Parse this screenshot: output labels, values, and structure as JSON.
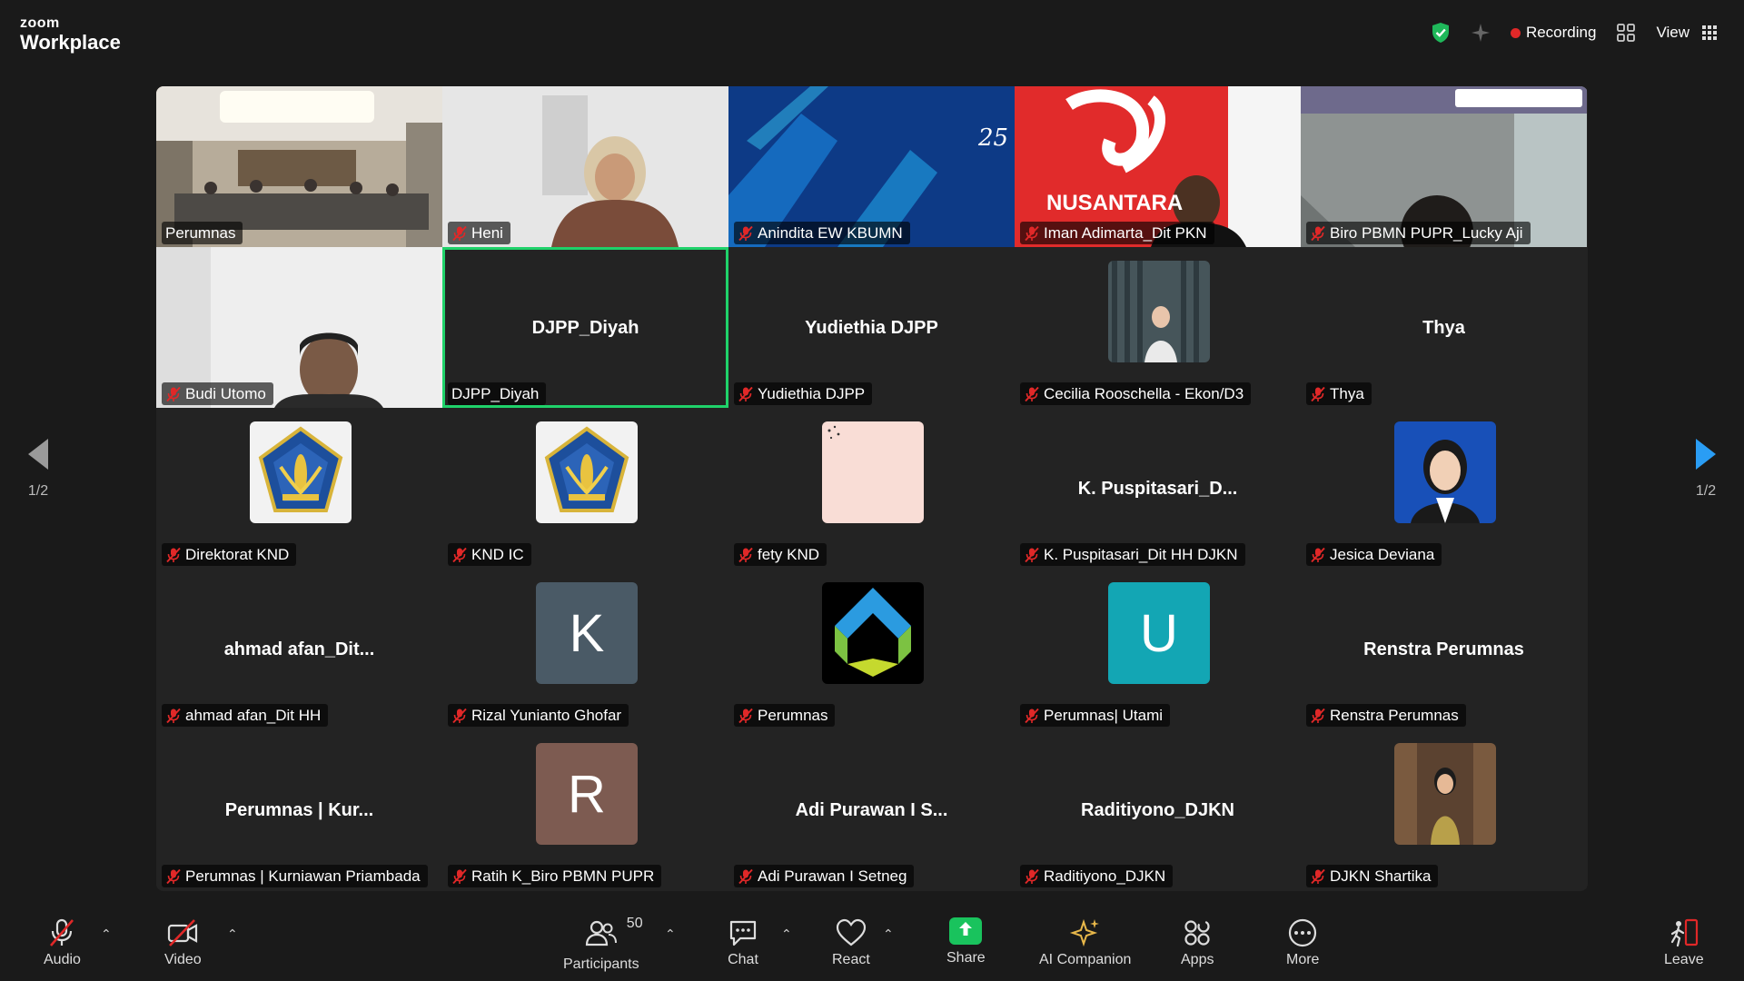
{
  "app": {
    "brand_small": "zoom",
    "brand_big": "Workplace"
  },
  "topbar": {
    "recording_label": "Recording",
    "view_label": "View"
  },
  "colors": {
    "accent_green": "#1fd26a",
    "recording_red": "#e02828",
    "arrow_blue": "#2a9df4",
    "mute_red": "#e02828"
  },
  "pages": {
    "left": "1/2",
    "right": "1/2"
  },
  "tiles": [
    {
      "name": "Perumnas",
      "muted": false,
      "kind": "video-room"
    },
    {
      "name": "Heni",
      "muted": true,
      "kind": "video-person"
    },
    {
      "name": "Anindita EW KBUMN",
      "muted": true,
      "kind": "video-blue"
    },
    {
      "name": "Iman Adimarta_Dit PKN",
      "muted": true,
      "kind": "video-red",
      "overlay_text": "NUSANTARA"
    },
    {
      "name": "Biro PBMN PUPR_Lucky Aji",
      "muted": true,
      "kind": "video-gray"
    },
    {
      "name": "Budi Utomo",
      "muted": true,
      "kind": "video-person2"
    },
    {
      "name": "DJPP_Diyah",
      "muted": false,
      "kind": "name",
      "center": "DJPP_Diyah",
      "active": true
    },
    {
      "name": "Yudiethia DJPP",
      "muted": true,
      "kind": "name",
      "center": "Yudiethia DJPP"
    },
    {
      "name": "Cecilia Rooschella - Ekon/D3",
      "muted": true,
      "kind": "photo-cecilia"
    },
    {
      "name": "Thya",
      "muted": true,
      "kind": "name",
      "center": "Thya"
    },
    {
      "name": "Direktorat KND",
      "muted": true,
      "kind": "emblem"
    },
    {
      "name": "KND IC",
      "muted": true,
      "kind": "emblem"
    },
    {
      "name": "fety KND",
      "muted": true,
      "kind": "pink"
    },
    {
      "name": "K. Puspitasari_Dit HH DJKN",
      "muted": true,
      "kind": "name",
      "center": "K.  Puspitasari_D..."
    },
    {
      "name": "Jesica Deviana",
      "muted": true,
      "kind": "photo-jesica"
    },
    {
      "name": "ahmad afan_Dit HH",
      "muted": true,
      "kind": "name",
      "center": "ahmad  afan_Dit..."
    },
    {
      "name": "Rizal Yunianto Ghofar",
      "muted": true,
      "kind": "letter",
      "letter": "K",
      "color": "#4a5a66"
    },
    {
      "name": "Perumnas",
      "muted": true,
      "kind": "perumnas-logo"
    },
    {
      "name": "Perumnas| Utami",
      "muted": true,
      "kind": "letter",
      "letter": "U",
      "color": "#13a6b4"
    },
    {
      "name": "Renstra Perumnas",
      "muted": true,
      "kind": "name",
      "center": "Renstra Perumnas"
    },
    {
      "name": "Perumnas | Kurniawan Priambada",
      "muted": true,
      "kind": "name",
      "center": "Perumnas | Kur..."
    },
    {
      "name": "Ratih K_Biro PBMN PUPR",
      "muted": true,
      "kind": "letter",
      "letter": "R",
      "color": "#7d5b51"
    },
    {
      "name": "Adi Purawan I Setneg",
      "muted": true,
      "kind": "name",
      "center": "Adi Purawan I S..."
    },
    {
      "name": "Raditiyono_DJKN",
      "muted": true,
      "kind": "name",
      "center": "Raditiyono_DJKN"
    },
    {
      "name": "DJKN Shartika",
      "muted": true,
      "kind": "photo-shartika"
    }
  ],
  "toolbar": {
    "audio": "Audio",
    "video": "Video",
    "participants": "Participants",
    "participants_count": "50",
    "chat": "Chat",
    "react": "React",
    "share": "Share",
    "ai": "AI Companion",
    "apps": "Apps",
    "more": "More",
    "leave": "Leave"
  }
}
